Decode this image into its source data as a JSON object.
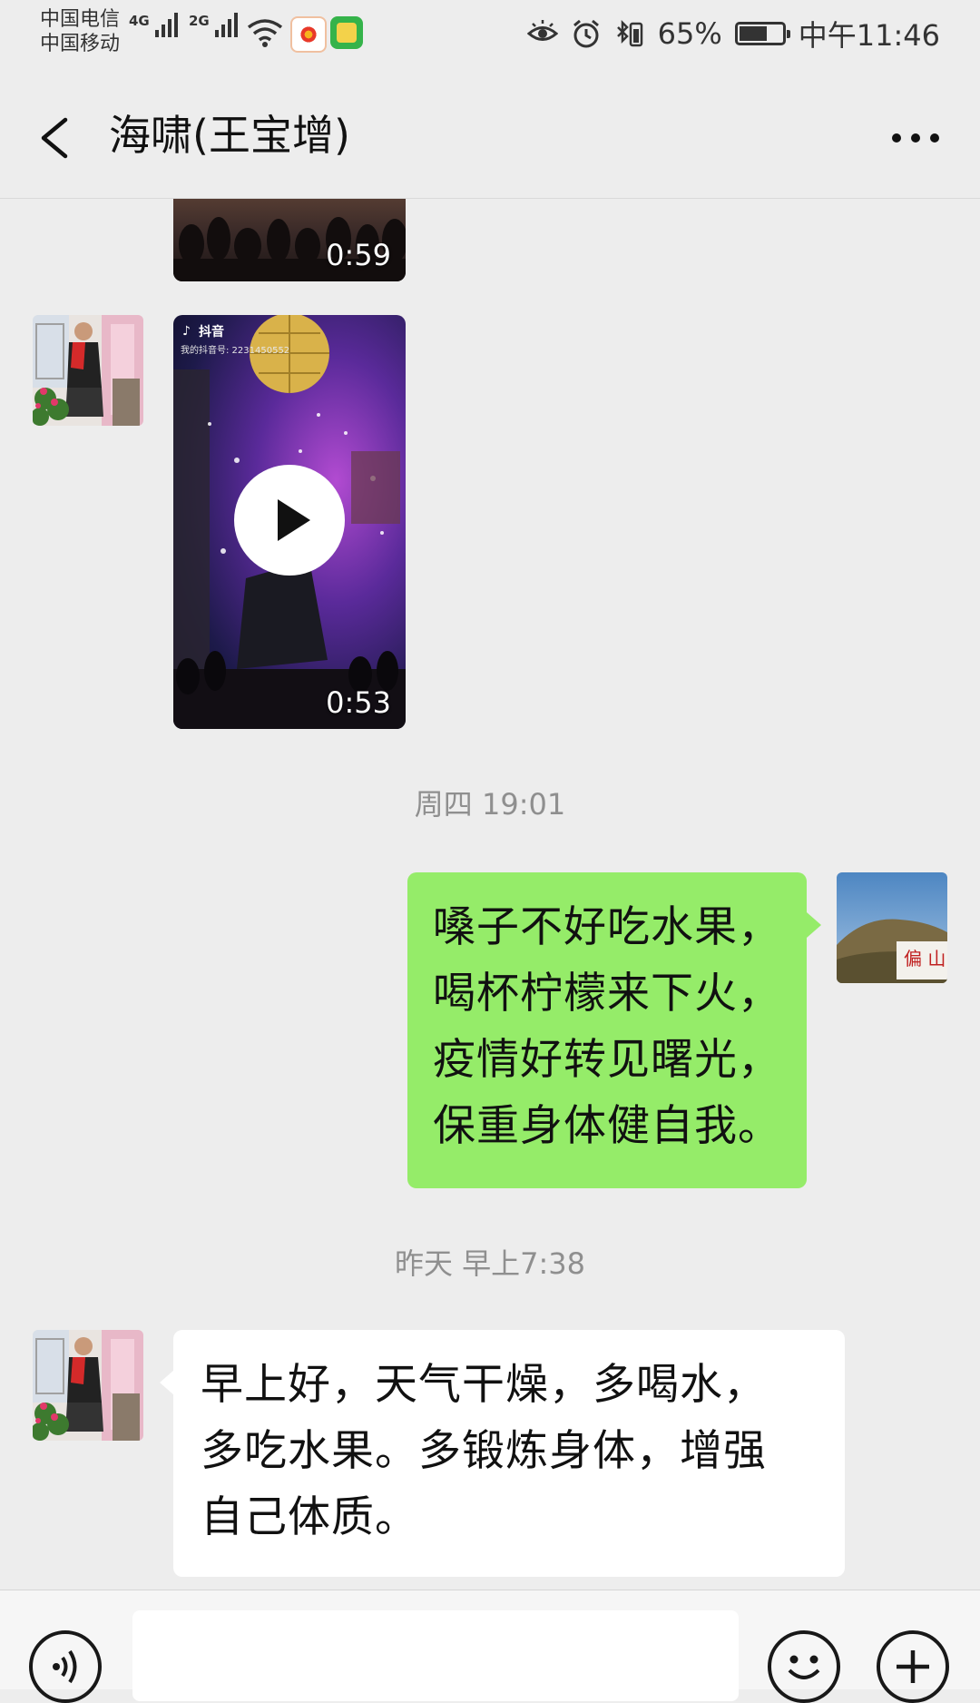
{
  "status_bar": {
    "carrier_1": "中国电信",
    "carrier_2": "中国移动",
    "network_1": "4G",
    "network_2": "2G",
    "battery_percent": "65%",
    "battery_level": 0.65,
    "time": "中午11:46"
  },
  "header": {
    "title": "海啸(王宝增)",
    "back_icon": "chevron-left-icon",
    "more_icon": "ellipsis-icon"
  },
  "messages": [
    {
      "type": "video",
      "sender": "other",
      "duration": "0:59"
    },
    {
      "type": "video",
      "sender": "other",
      "duration": "0:53",
      "overlay_brand": "抖音",
      "overlay_id": "我的抖音号: 2231450552"
    },
    {
      "type": "timestamp",
      "text": "周四 19:01"
    },
    {
      "type": "text",
      "sender": "me",
      "lines": [
        "嗓子不好吃水果，",
        "喝杯柠檬来下火，",
        "疫情好转见曙光，",
        "保重身体健自我。"
      ]
    },
    {
      "type": "timestamp",
      "text": "昨天 早上7:38"
    },
    {
      "type": "text",
      "sender": "other",
      "lines": [
        "早上好，天气干燥，多喝水，",
        "多吃水果。多锻炼身体，增强",
        "自己体质。"
      ]
    }
  ],
  "input_bar": {
    "value": "",
    "voice_icon": "voice-icon",
    "emoji_icon": "emoji-icon",
    "plus_icon": "plus-icon"
  },
  "colors": {
    "background": "#EDEDED",
    "my_bubble": "#95EC69",
    "their_bubble": "#FFFFFF",
    "timestamp_text": "#8F8F8F"
  }
}
